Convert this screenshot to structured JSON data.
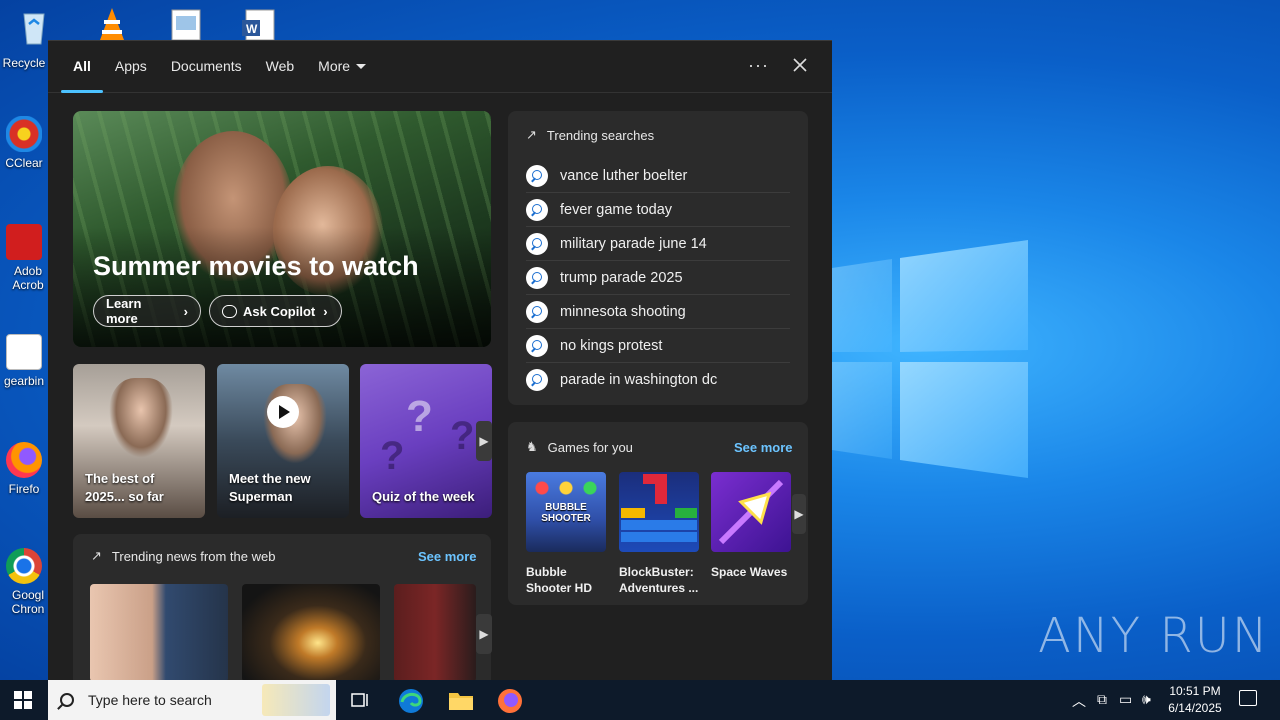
{
  "desktop": {
    "icons": [
      {
        "label": "Recycle",
        "name": "recycle-bin"
      },
      {
        "label": "CClear",
        "name": "ccleaner"
      },
      {
        "label": "Adob Acrob",
        "name": "adobe-acrobat"
      },
      {
        "label": "gearbin",
        "name": "gearbin"
      },
      {
        "label": "Firefo",
        "name": "firefox"
      },
      {
        "label": "Googl Chron",
        "name": "google-chrome"
      }
    ],
    "watermark": "ANY RUN"
  },
  "search_panel": {
    "tabs": [
      {
        "label": "All",
        "active": true
      },
      {
        "label": "Apps"
      },
      {
        "label": "Documents"
      },
      {
        "label": "Web"
      },
      {
        "label": "More"
      }
    ],
    "more_options_label": "···",
    "hero": {
      "title": "Summer movies to watch",
      "learn_more": "Learn more",
      "ask_copilot": "Ask Copilot"
    },
    "cards": [
      {
        "label": "The best of 2025... so far"
      },
      {
        "label": "Meet the new Superman"
      },
      {
        "label": "Quiz of the week"
      }
    ],
    "trending_news": {
      "title": "Trending news from the web",
      "see_more": "See more"
    },
    "trending_searches": {
      "title": "Trending searches",
      "items": [
        "vance luther boelter",
        "fever game today",
        "military parade june 14",
        "trump parade 2025",
        "minnesota shooting",
        "no kings protest",
        "parade in washington dc"
      ]
    },
    "games": {
      "title": "Games for you",
      "see_more": "See more",
      "items": [
        {
          "name": "Bubble Shooter HD",
          "image_text": "BUBBLE SHOOTER"
        },
        {
          "name": "BlockBuster: Adventures ..."
        },
        {
          "name": "Space Waves"
        }
      ]
    }
  },
  "taskbar": {
    "search_placeholder": "Type here to search",
    "time": "10:51 PM",
    "date": "6/14/2025"
  },
  "colors": {
    "accent": "#4cc2ff",
    "link": "#6cc4ff",
    "panel_bg": "#202020",
    "card_bg": "#2b2b2b"
  }
}
